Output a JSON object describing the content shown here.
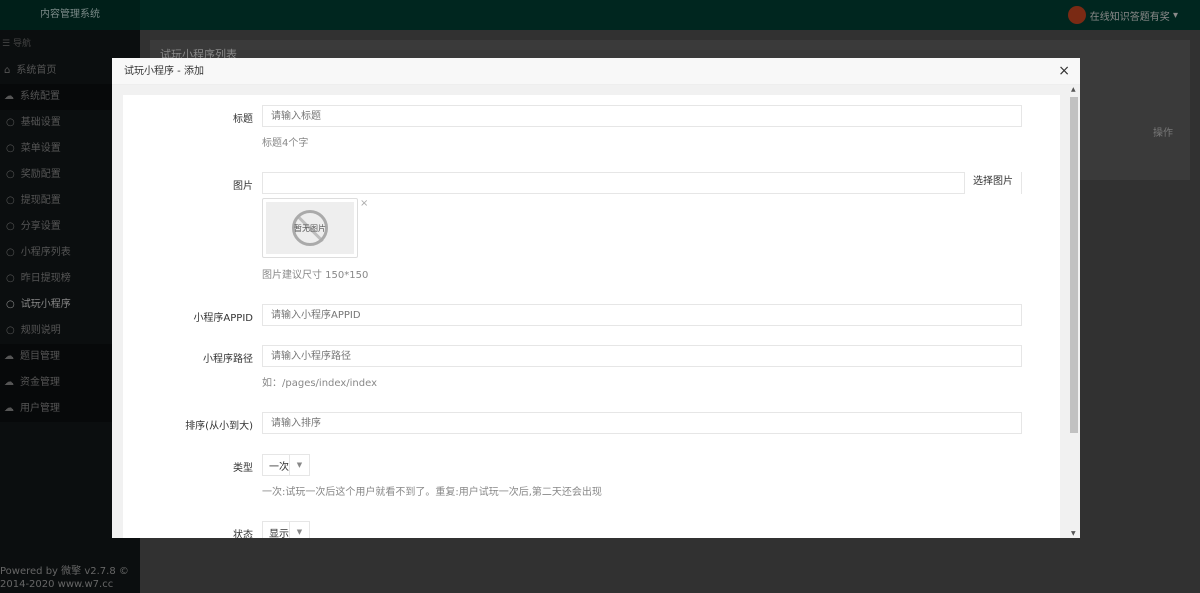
{
  "header": {
    "logo": "内容管理系统",
    "user": "在线知识答题有奖"
  },
  "sidebar": {
    "nav_title": "导航",
    "items": [
      {
        "label": "系统首页",
        "type": "top"
      },
      {
        "label": "系统配置",
        "type": "group"
      },
      {
        "label": "基础设置",
        "type": "sub"
      },
      {
        "label": "菜单设置",
        "type": "sub"
      },
      {
        "label": "奖励配置",
        "type": "sub"
      },
      {
        "label": "提现配置",
        "type": "sub"
      },
      {
        "label": "分享设置",
        "type": "sub"
      },
      {
        "label": "小程序列表",
        "type": "sub"
      },
      {
        "label": "昨日提现榜",
        "type": "sub"
      },
      {
        "label": "试玩小程序",
        "type": "sub",
        "active": true
      },
      {
        "label": "规则说明",
        "type": "sub"
      },
      {
        "label": "题目管理",
        "type": "group"
      },
      {
        "label": "资金管理",
        "type": "group"
      },
      {
        "label": "用户管理",
        "type": "group"
      }
    ],
    "footer_line1": "Powered by 微擎 v2.7.8 ©",
    "footer_line2": "2014-2020 www.w7.cc"
  },
  "main": {
    "title": "试玩小程序列表",
    "col_action": "操作"
  },
  "modal": {
    "title": "试玩小程序 - 添加",
    "close": "×",
    "fields": {
      "title": {
        "label": "标题",
        "placeholder": "请输入标题",
        "hint": "标题4个字"
      },
      "image": {
        "label": "图片",
        "button": "选择图片",
        "no_image": "暂无图片",
        "remove": "×",
        "hint": "图片建议尺寸 150*150"
      },
      "appid": {
        "label": "小程序APPID",
        "placeholder": "请输入小程序APPID"
      },
      "path": {
        "label": "小程序路径",
        "placeholder": "请输入小程序路径",
        "hint": "如：/pages/index/index"
      },
      "sort": {
        "label": "排序(从小到大)",
        "placeholder": "请输入排序"
      },
      "type": {
        "label": "类型",
        "value": "一次",
        "hint": "一次:试玩一次后这个用户就看不到了。重复:用户试玩一次后,第二天还会出现"
      },
      "status": {
        "label": "状态",
        "value": "显示"
      }
    }
  }
}
